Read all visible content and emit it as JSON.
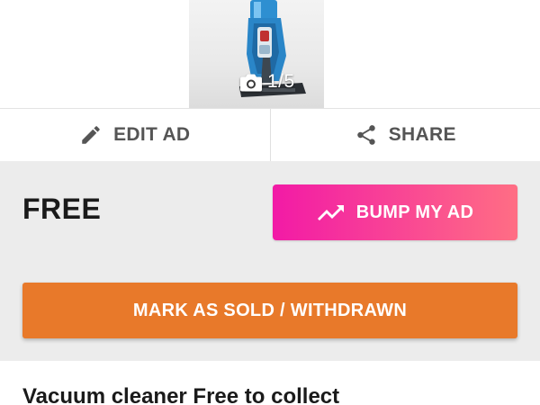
{
  "gallery": {
    "photo_counter": "1/5"
  },
  "actions": {
    "edit_label": "EDIT AD",
    "share_label": "SHARE"
  },
  "listing": {
    "price": "FREE",
    "title": "Vacuum cleaner Free to collect"
  },
  "buttons": {
    "bump_label": "BUMP MY AD",
    "mark_sold_label": "MARK AS SOLD / WITHDRAWN"
  },
  "colors": {
    "bump_gradient_start": "#f21aa6",
    "bump_gradient_end": "#ff6e84",
    "mark_sold": "#e8792a",
    "section_background": "#ececec"
  },
  "icons": {
    "camera": "camera-icon",
    "edit": "pencil-icon",
    "share": "share-icon",
    "bump": "trending-up-icon"
  }
}
